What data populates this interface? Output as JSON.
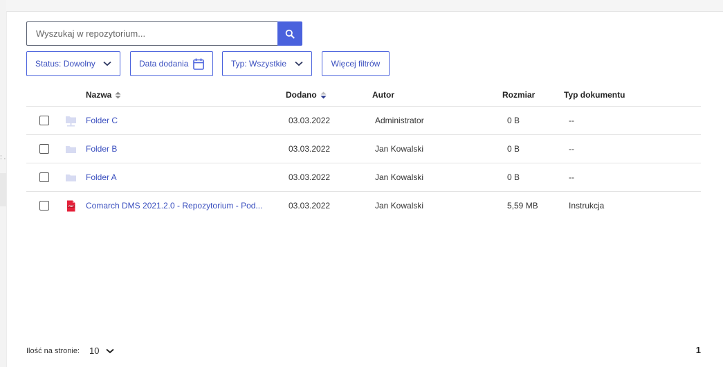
{
  "search": {
    "placeholder": "Wyszukaj w repozytorium..."
  },
  "filters": {
    "status": "Status: Dowolny",
    "date": "Data dodania",
    "type": "Typ: Wszystkie",
    "more": "Więcej filtrów"
  },
  "table": {
    "headers": {
      "name": "Nazwa",
      "added": "Dodano",
      "author": "Autor",
      "size": "Rozmiar",
      "doc_type": "Typ dokumentu"
    },
    "rows": [
      {
        "name": "Folder C",
        "date": "03.03.2022",
        "author": "Administrator",
        "size": "0 B",
        "type": "--"
      },
      {
        "name": "Folder B",
        "date": "03.03.2022",
        "author": "Jan Kowalski",
        "size": "0 B",
        "type": "--"
      },
      {
        "name": "Folder A",
        "date": "03.03.2022",
        "author": "Jan Kowalski",
        "size": "0 B",
        "type": "--"
      },
      {
        "name": "Comarch DMS 2021.2.0 - Repozytorium - Pod...",
        "date": "03.03.2022",
        "author": "Jan Kowalski",
        "size": "5,59 MB",
        "type": "Instrukcja"
      }
    ]
  },
  "footer": {
    "per_page_label": "Ilość na stronie:",
    "per_page_value": "10",
    "page": "1"
  },
  "side_text": ": ."
}
